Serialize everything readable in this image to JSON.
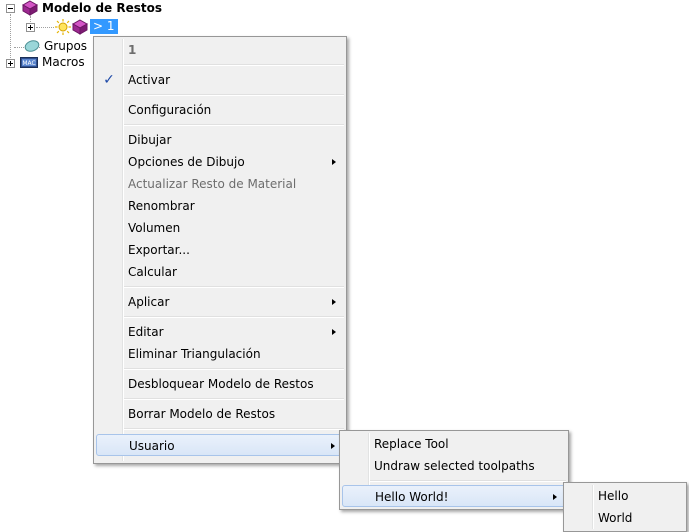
{
  "tree": {
    "root_label": "Modelo de Restos",
    "child_label": "> 1",
    "groups_label": "Grupos",
    "macros_label": "Macros"
  },
  "context_menu": {
    "header": "1",
    "items": [
      {
        "label": "Activar",
        "checked": true
      },
      {
        "label": "Configuración"
      },
      {
        "label": "Dibujar"
      },
      {
        "label": "Opciones de Dibujo",
        "submenu": true
      },
      {
        "label": "Actualizar Resto de Material",
        "disabled": true
      },
      {
        "label": "Renombrar"
      },
      {
        "label": "Volumen"
      },
      {
        "label": "Exportar..."
      },
      {
        "label": "Calcular"
      },
      {
        "label": "Aplicar",
        "submenu": true
      },
      {
        "label": "Editar",
        "submenu": true
      },
      {
        "label": "Eliminar Triangulación"
      },
      {
        "label": "Desbloquear Modelo de Restos"
      },
      {
        "label": "Borrar Modelo de Restos"
      },
      {
        "label": "Usuario",
        "submenu": true,
        "highlighted": true
      }
    ],
    "check_glyph": "✓"
  },
  "usuario_menu": {
    "items": [
      {
        "label": "Replace Tool"
      },
      {
        "label": "Undraw selected toolpaths"
      },
      {
        "label": "Hello World!",
        "submenu": true,
        "highlighted": true
      }
    ]
  },
  "hello_menu": {
    "items": [
      {
        "label": "Hello"
      },
      {
        "label": "World"
      }
    ]
  },
  "colors": {
    "menu_bg": "#f0f0f0",
    "selection": "#3399ff",
    "highlight_border": "#a8c4ea",
    "model_icon": "#a8329a"
  }
}
